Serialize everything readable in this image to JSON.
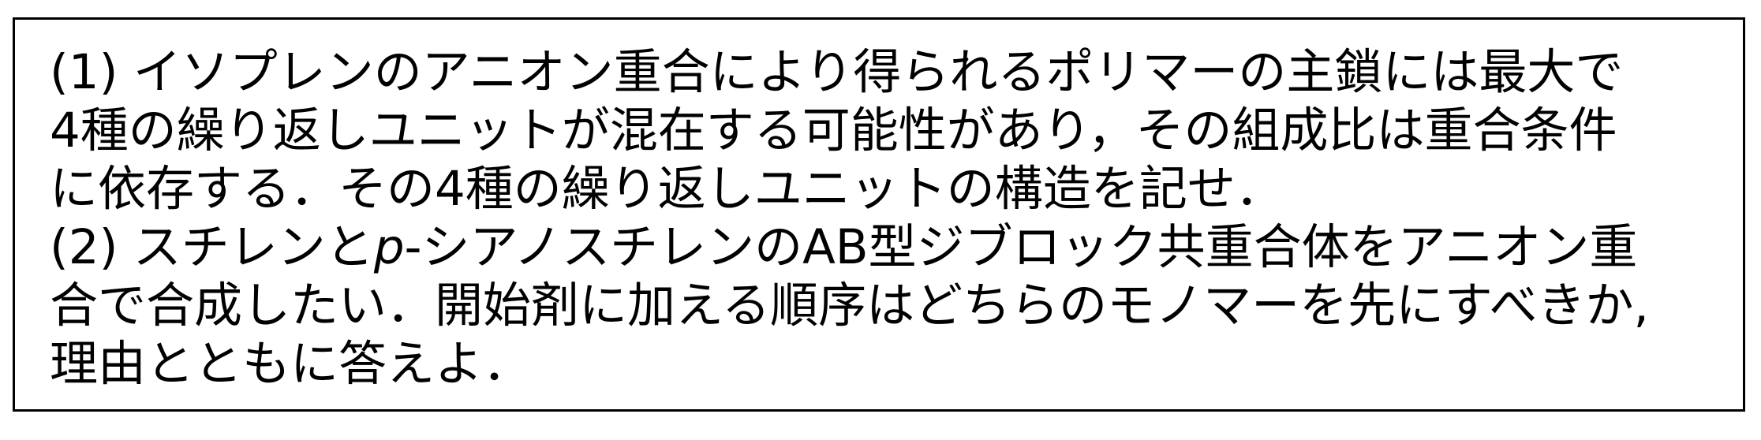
{
  "question": {
    "part1": {
      "line1": "(1) イソプレンのアニオン重合により得られるポリマーの主鎖には最大で",
      "line2": "4種の繰り返しユニットが混在する可能性があり，その組成比は重合条件",
      "line3": "に依存する．その4種の繰り返しユニットの構造を記せ．"
    },
    "part2": {
      "line1_pre": "(2) スチレンと",
      "line1_italic": "p",
      "line1_post": "-シアノスチレンのAB型ジブロック共重合体をアニオン重",
      "line2": "合で合成したい．開始剤に加える順序はどちらのモノマーを先にすべきか,",
      "line3": "理由とともに答えよ．"
    }
  }
}
